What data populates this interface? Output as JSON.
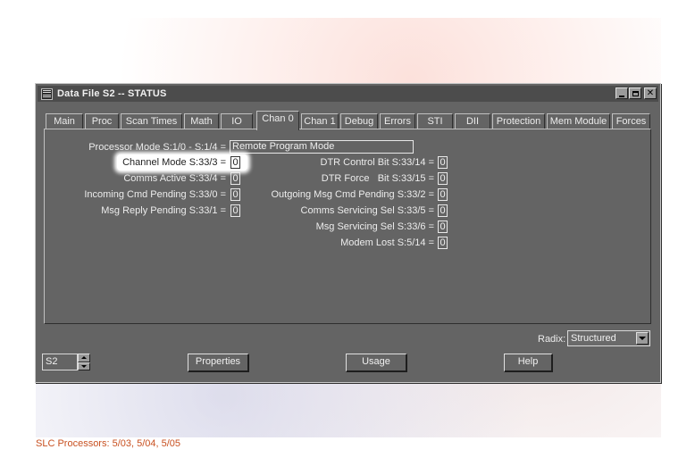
{
  "window": {
    "title": "Data File S2  --  STATUS",
    "minimize_glyph": "_",
    "maximize_glyph": "□",
    "close_glyph": "✕"
  },
  "tabs": [
    {
      "label": "Main"
    },
    {
      "label": "Proc"
    },
    {
      "label": "Scan Times"
    },
    {
      "label": "Math"
    },
    {
      "label": "IO"
    },
    {
      "label": "Chan 0",
      "active": true
    },
    {
      "label": "Chan 1"
    },
    {
      "label": "Debug"
    },
    {
      "label": "Errors"
    },
    {
      "label": "STI"
    },
    {
      "label": "DII"
    },
    {
      "label": "Protection"
    },
    {
      "label": "Mem Module"
    },
    {
      "label": "Forces"
    }
  ],
  "processor_mode": {
    "label": "Processor Mode S:1/0 - S:1/4 =",
    "value": "Remote Program Mode"
  },
  "left_fields": [
    {
      "label": "Channel Mode S:33/3 =",
      "value": "0",
      "highlighted": true
    },
    {
      "label": "Comms Active S:33/4 =",
      "value": "0"
    },
    {
      "label": "Incoming Cmd Pending S:33/0 =",
      "value": "0"
    },
    {
      "label": "Msg Reply Pending S:33/1 =",
      "value": "0"
    }
  ],
  "right_fields": [
    {
      "label": "DTR Control Bit S:33/14 =",
      "value": "0"
    },
    {
      "label": "DTR Force   Bit S:33/15 =",
      "value": "0"
    },
    {
      "label": "Outgoing Msg Cmd Pending S:33/2 =",
      "value": "0"
    },
    {
      "label": "Comms Servicing Sel S:33/5 =",
      "value": "0"
    },
    {
      "label": "Msg Servicing Sel S:33/6 =",
      "value": "0"
    },
    {
      "label": "Modem Lost S:5/14 =",
      "value": "0"
    }
  ],
  "radix": {
    "label": "Radix:",
    "selected": "Structured"
  },
  "file_stepper": {
    "value": "S2"
  },
  "buttons": {
    "properties": "Properties",
    "usage": "Usage",
    "help": "Help"
  },
  "caption": "SLC Processors:  5/03, 5/04, 5/05",
  "icons": {
    "app": "data-file-icon",
    "dropdown": "chevron-down-icon",
    "stepper_up": "arrow-up-icon",
    "stepper_down": "arrow-down-icon"
  },
  "colors": {
    "window_bg": "#646464",
    "titlebar_bg": "#4c4c4c",
    "caption_text": "#c85020",
    "highlight": "#ffffff"
  }
}
